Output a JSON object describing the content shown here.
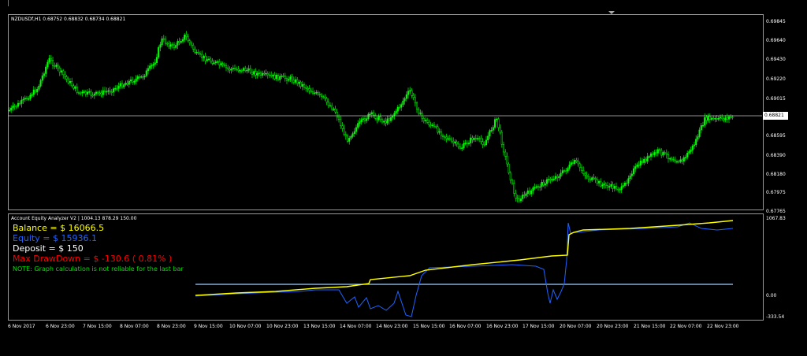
{
  "main_chart": {
    "title": "NZDUSDf,H1  0.68752 0.68832 0.68734 0.68821",
    "y_ticks": [
      "0.69845",
      "0.69640",
      "0.69430",
      "0.69220",
      "0.69015",
      "0.68595",
      "0.68390",
      "0.68180",
      "0.67975",
      "0.67765"
    ],
    "current_price": "0.68821",
    "colors": {
      "candle": "#00ff00",
      "price_line": "#c0c0c0",
      "border": "#9a9a9a"
    }
  },
  "indicator": {
    "title": "Account Equity Analyzer V2 | 1004.13 878.29 150.00",
    "y_ticks": [
      "1067.83",
      "0.00",
      "-333.54"
    ],
    "balance_label": "Balance = $ 16066.5",
    "equity_label": "Equity     = $ 15936.1",
    "deposit_label": "Deposit  = $ 150",
    "drawdown_label": "Max DrawDown = $ -130.6  ( 0.81% )",
    "note": "NOTE: Graph calculation is not reliable for the last bar",
    "colors": {
      "balance": "#ffff00",
      "equity": "#1e64ff",
      "deposit": "#a0d0ff",
      "drawdown": "#ff0000",
      "note": "#00dd00"
    }
  },
  "x_axis": [
    "6 Nov 2017",
    "6 Nov 23:00",
    "7 Nov 15:00",
    "8 Nov 07:00",
    "8 Nov 23:00",
    "9 Nov 15:00",
    "10 Nov 07:00",
    "10 Nov 23:00",
    "13 Nov 15:00",
    "14 Nov 07:00",
    "14 Nov 23:00",
    "15 Nov 15:00",
    "16 Nov 07:00",
    "16 Nov 23:00",
    "17 Nov 15:00",
    "20 Nov 07:00",
    "20 Nov 23:00",
    "21 Nov 15:00",
    "22 Nov 07:00",
    "22 Nov 23:00"
  ]
}
